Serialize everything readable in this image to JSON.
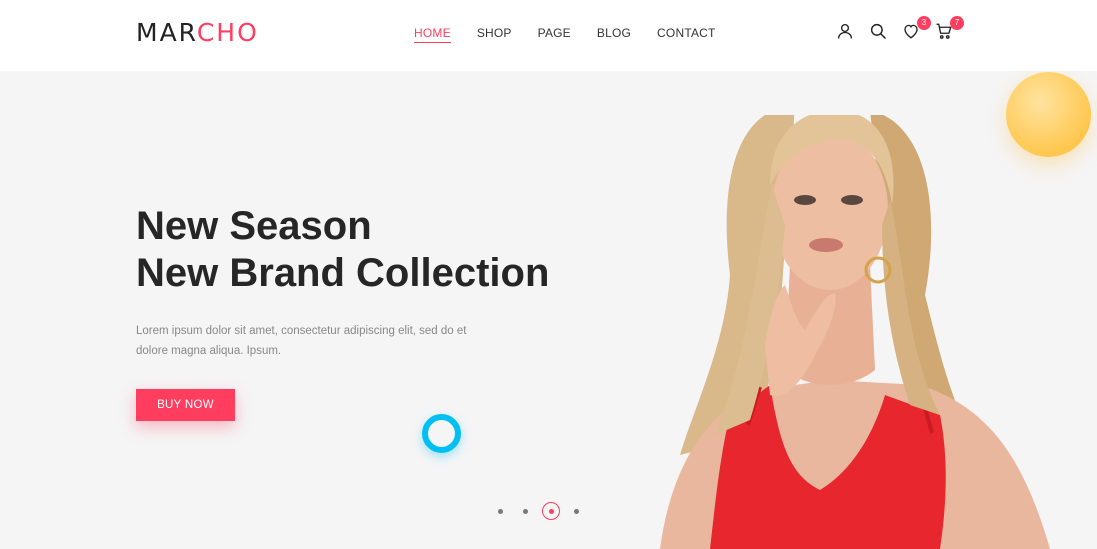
{
  "brand": {
    "logo_dark": "MAR",
    "logo_accent": "CHO"
  },
  "nav": {
    "items": [
      {
        "label": "HOME",
        "active": true
      },
      {
        "label": "SHOP",
        "active": false
      },
      {
        "label": "PAGE",
        "active": false
      },
      {
        "label": "BLOG",
        "active": false
      },
      {
        "label": "CONTACT",
        "active": false
      }
    ]
  },
  "header_icons": {
    "user": "user-icon",
    "search": "search-icon",
    "wishlist": "heart-icon",
    "wishlist_count": "3",
    "cart": "cart-icon",
    "cart_count": "7"
  },
  "hero": {
    "headline_line1": "New Season",
    "headline_line2": "New Brand Collection",
    "description": "Lorem ipsum dolor sit amet, consectetur adipiscing elit, sed do et dolore magna aliqua. Ipsum.",
    "button_label": "BUY NOW"
  },
  "slider": {
    "total": 4,
    "active_index": 3
  },
  "colors": {
    "accent": "#ff3e5f",
    "ring": "#00bff3",
    "sun": "#ffc74f",
    "hero_bg": "#f5f5f6",
    "dress": "#e8262d"
  }
}
